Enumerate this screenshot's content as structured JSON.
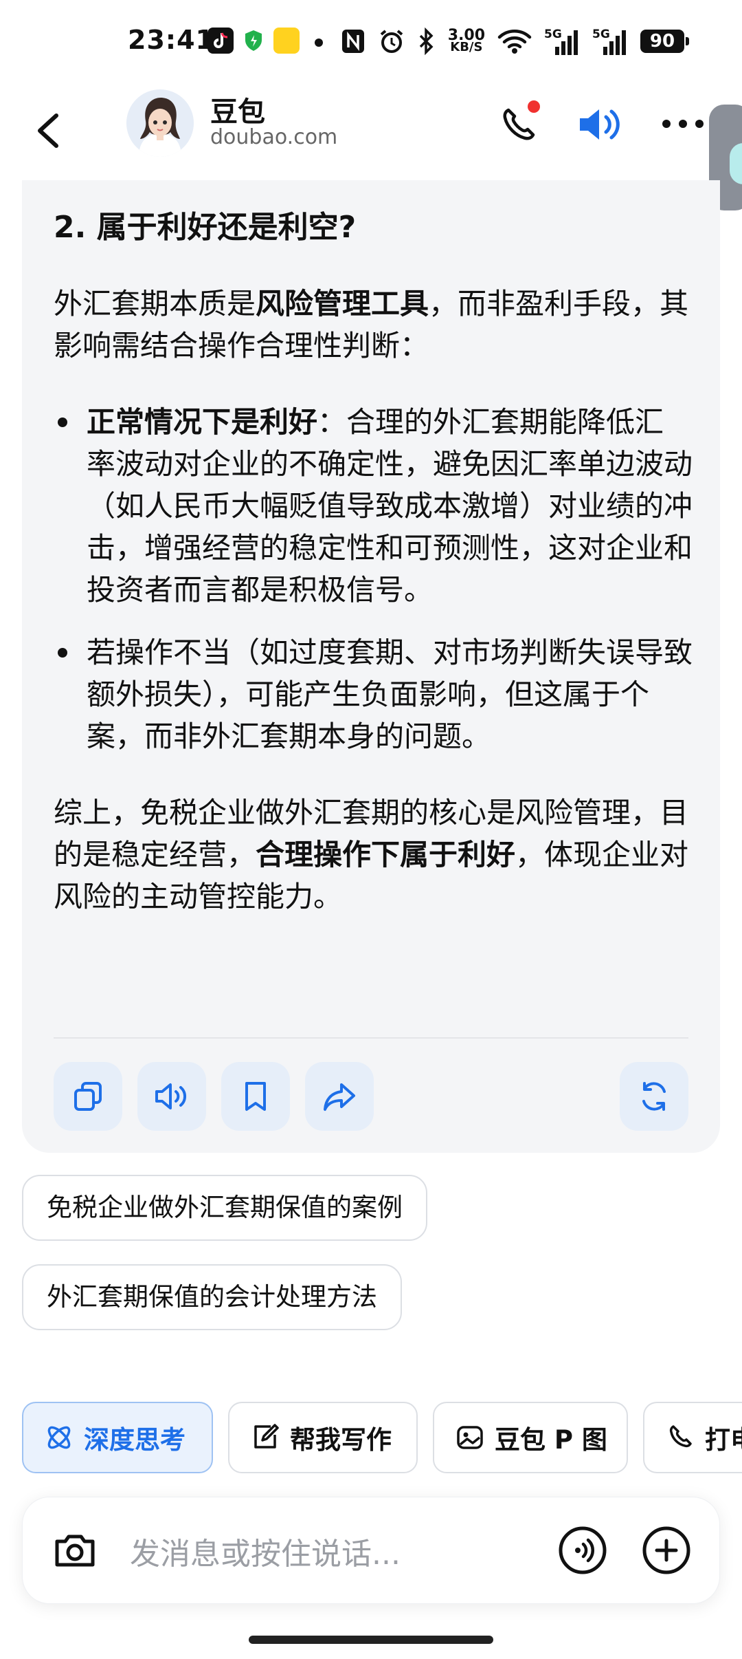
{
  "status_bar": {
    "time": "23:41",
    "net_speed_value": "3.00",
    "net_speed_unit": "KB/S",
    "network_1": "5G",
    "network_2": "5G",
    "battery": "90"
  },
  "header": {
    "bot_name": "豆包",
    "bot_domain": "doubao.com"
  },
  "answer": {
    "heading": "2. 属于利好还是利空?",
    "intro_prefix": "外汇套期本质是",
    "intro_bold": "风险管理工具",
    "intro_suffix": "，而非盈利手段，其影响需结合操作合理性判断：",
    "bullet1_bold": "正常情况下是利好",
    "bullet1_text": "：合理的外汇套期能降低汇率波动对企业的不确定性，避免因汇率单边波动（如人民币大幅贬值导致成本激增）对业绩的冲击，增强经营的稳定性和可预测性，这对企业和投资者而言都是积极信号。",
    "bullet2_text": "若操作不当（如过度套期、对市场判断失误导致额外损失），可能产生负面影响，但这属于个案，而非外汇套期本身的问题。",
    "summary_prefix": "综上，免税企业做外汇套期的核心是风险管理，目的是稳定经营，",
    "summary_bold": "合理操作下属于利好",
    "summary_suffix": "，体现企业对风险的主动管控能力。"
  },
  "actions": {
    "icons": [
      "copy-icon",
      "speaker-icon",
      "bookmark-icon",
      "share-icon",
      "refresh-icon"
    ],
    "accent_color": "#1e6fe8"
  },
  "suggestions": [
    "免税企业做外汇套期保值的案例",
    "外汇套期保值的会计处理方法"
  ],
  "tools": {
    "deep_think": "深度思考",
    "help_write": "帮我写作",
    "photo_edit": "豆包 P 图",
    "call": "打电"
  },
  "input": {
    "placeholder": "发消息或按住说话..."
  }
}
